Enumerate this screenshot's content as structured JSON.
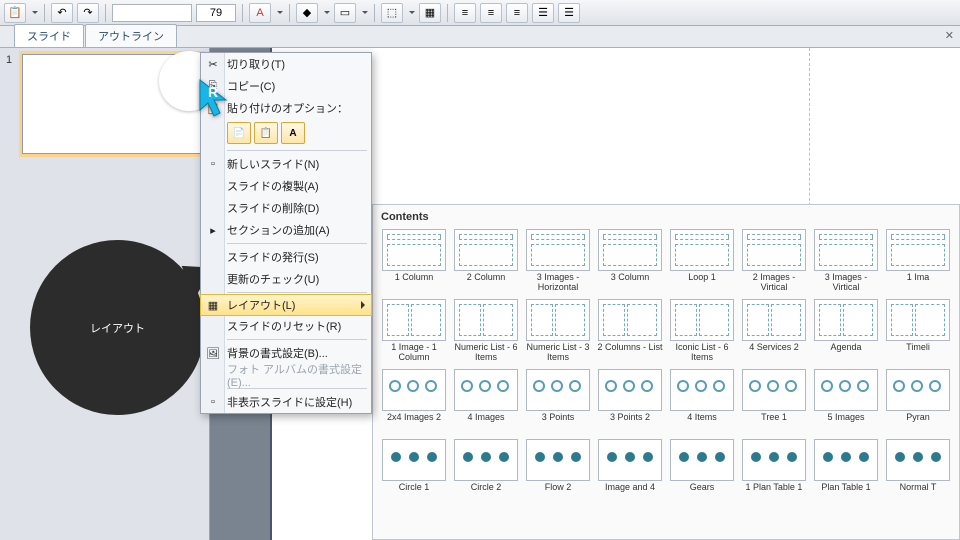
{
  "toolbar": {
    "font_size": "79"
  },
  "tabs": {
    "slide": "スライド",
    "outline": "アウトライン"
  },
  "slide_number": "1",
  "cursor_label": "R",
  "context_menu": {
    "cut": "切り取り(T)",
    "copy": "コピー(C)",
    "paste_header": "貼り付けのオプション：",
    "paste_a": "A",
    "new_slide": "新しいスライド(N)",
    "duplicate": "スライドの複製(A)",
    "delete": "スライドの削除(D)",
    "add_section": "セクションの追加(A)",
    "publish": "スライドの発行(S)",
    "check_update": "更新のチェック(U)",
    "layout": "レイアウト(L)",
    "reset": "スライドのリセット(R)",
    "background": "背景の書式設定(B)...",
    "photo_album": "フォト アルバムの書式設定(E)...",
    "hide_slide": "非表示スライドに設定(H)"
  },
  "callout": "レイアウト",
  "gallery": {
    "title": "Contents",
    "items": [
      "1 Column",
      "2 Column",
      "3 Images - Horizontal",
      "3 Column",
      "Loop 1",
      "2 Images - Virtical",
      "3 Images - Virtical",
      "1 Ima",
      "1 Image - 1 Column",
      "Numeric List - 6 Items",
      "Numeric List - 3 Items",
      "2 Columns - List",
      "Iconic List - 6 Items",
      "4 Services 2",
      "Agenda",
      "Timeli",
      "2x4 Images 2",
      "4 Images",
      "3 Points",
      "3 Points 2",
      "4 Items",
      "Tree 1",
      "5 Images",
      "Pyran",
      "Circle 1",
      "Circle 2",
      "Flow 2",
      "Image and 4",
      "Gears",
      "1 Plan Table 1",
      "Plan Table 1",
      "Normal T"
    ]
  }
}
